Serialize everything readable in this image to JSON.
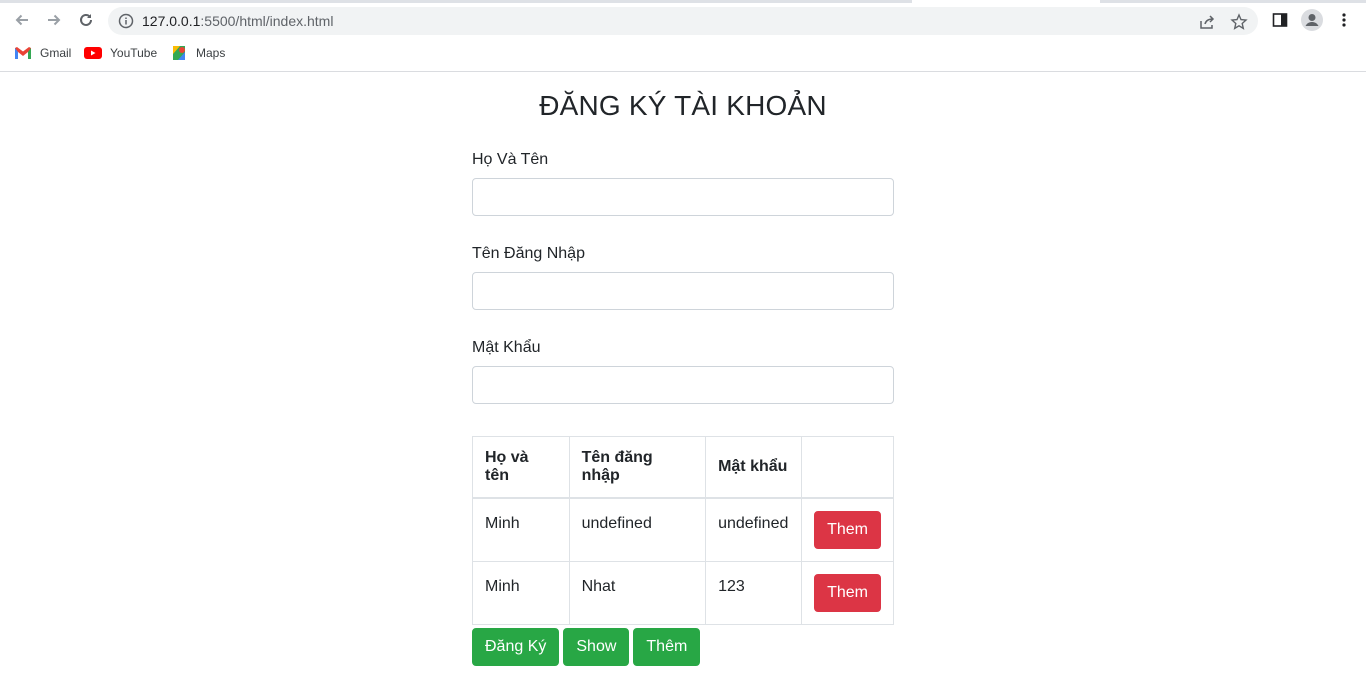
{
  "browser": {
    "url_host": "127.0.0.1",
    "url_rest": ":5500/html/index.html",
    "bookmarks": [
      {
        "label": "Gmail",
        "icon": "gmail-icon"
      },
      {
        "label": "YouTube",
        "icon": "youtube-icon"
      },
      {
        "label": "Maps",
        "icon": "maps-icon"
      }
    ]
  },
  "page": {
    "title": "ĐĂNG KÝ TÀI KHOẢN",
    "form": {
      "fullname_label": "Họ Và Tên",
      "fullname_value": "",
      "username_label": "Tên Đăng Nhập",
      "username_value": "",
      "password_label": "Mật Khẩu",
      "password_value": ""
    },
    "table": {
      "headers": [
        "Họ và tên",
        "Tên đăng nhập",
        "Mật khẩu",
        ""
      ],
      "rows": [
        {
          "fullname": "Minh",
          "username": "undefined",
          "password": "undefined",
          "action": "Them"
        },
        {
          "fullname": "Minh",
          "username": "Nhat",
          "password": "123",
          "action": "Them"
        }
      ]
    },
    "buttons": {
      "register": "Đăng Ký",
      "show": "Show",
      "add": "Thêm"
    }
  },
  "colors": {
    "danger": "#dc3545",
    "success": "#28a745"
  }
}
